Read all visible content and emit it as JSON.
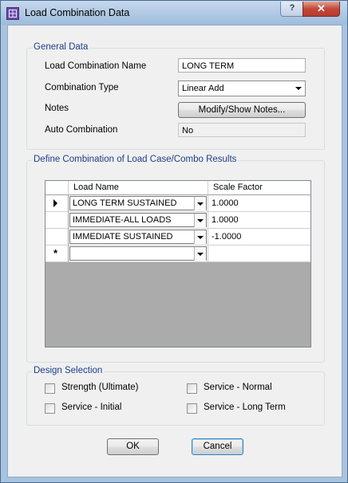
{
  "window": {
    "title": "Load Combination Data",
    "help_label": "?",
    "close_label": "✕"
  },
  "general": {
    "group_label": "General Data",
    "name_label": "Load Combination Name",
    "name_value": "LONG TERM",
    "type_label": "Combination Type",
    "type_value": "Linear Add",
    "notes_label": "Notes",
    "notes_button": "Modify/Show Notes...",
    "auto_label": "Auto Combination",
    "auto_value": "No"
  },
  "define": {
    "group_label": "Define Combination of Load Case/Combo Results",
    "columns": [
      "Load Name",
      "Scale Factor"
    ],
    "rows": [
      {
        "load": "LONG TERM SUSTAINED",
        "factor": "1.0000",
        "marker": "current"
      },
      {
        "load": "IMMEDIATE-ALL LOADS",
        "factor": "1.0000",
        "marker": ""
      },
      {
        "load": "IMMEDIATE SUSTAINED",
        "factor": "-1.0000",
        "marker": ""
      },
      {
        "load": "",
        "factor": "",
        "marker": "new"
      }
    ],
    "new_row_symbol": "*"
  },
  "design": {
    "group_label": "Design Selection",
    "strength": "Strength (Ultimate)",
    "service_initial": "Service - Initial",
    "service_normal": "Service - Normal",
    "service_long": "Service - Long Term"
  },
  "buttons": {
    "ok": "OK",
    "cancel": "Cancel"
  },
  "icons": {
    "app": "grid-app-icon",
    "current_row": "current-row-arrow-icon"
  }
}
